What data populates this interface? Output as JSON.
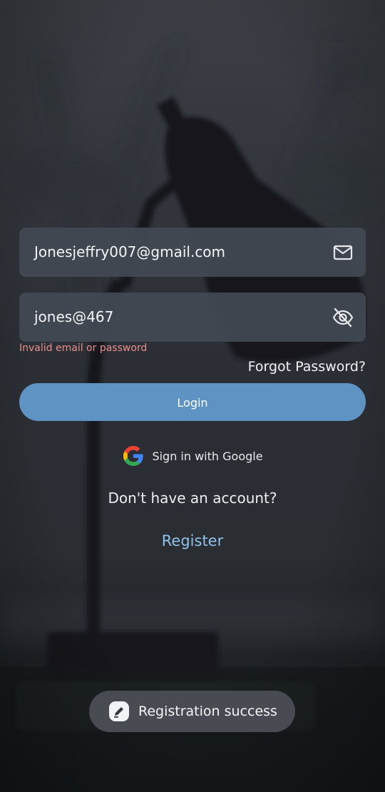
{
  "login_form": {
    "email": {
      "value": "Jonesjeffry007@gmail.com",
      "icon": "mail-icon"
    },
    "password": {
      "value": "jones@467",
      "icon": "eye-off-icon"
    },
    "error": "Invalid email or password",
    "forgot_password": "Forgot Password?",
    "login_label": "Login"
  },
  "google_signin": {
    "label": "Sign in with Google",
    "icon": "google-logo-icon"
  },
  "register_prompt": {
    "question": "Don't have an account?",
    "link": "Register"
  },
  "toast": {
    "message": "Registration success",
    "icon": "app-icon"
  },
  "colors": {
    "accent": "#5e93c3",
    "link": "#8fc1ea",
    "error": "#e98f8b",
    "field_bg": "#424851"
  }
}
